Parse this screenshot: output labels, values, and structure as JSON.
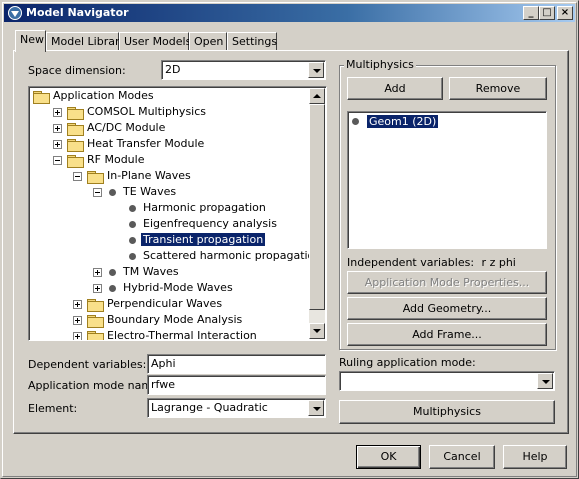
{
  "window": {
    "title": "Model Navigator"
  },
  "titlebar_buttons": {
    "minimize": "_",
    "maximize": "□",
    "close": "×"
  },
  "tabs": [
    {
      "label": "New",
      "active": true
    },
    {
      "label": "Model Library",
      "active": false
    },
    {
      "label": "User Models",
      "active": false
    },
    {
      "label": "Open",
      "active": false
    },
    {
      "label": "Settings",
      "active": false
    }
  ],
  "left": {
    "space_dimension_label": "Space dimension:",
    "space_dimension_value": "2D",
    "tree": [
      {
        "label": "Application Modes",
        "type": "folder",
        "level": 0,
        "expander": "minus"
      },
      {
        "label": "COMSOL Multiphysics",
        "type": "folder",
        "level": 1,
        "expander": "plus"
      },
      {
        "label": "AC/DC Module",
        "type": "folder",
        "level": 1,
        "expander": "plus"
      },
      {
        "label": "Heat Transfer Module",
        "type": "folder",
        "level": 1,
        "expander": "plus"
      },
      {
        "label": "RF Module",
        "type": "folder",
        "level": 1,
        "expander": "minus"
      },
      {
        "label": "In-Plane Waves",
        "type": "folder",
        "level": 2,
        "expander": "minus"
      },
      {
        "label": "TE Waves",
        "type": "dot",
        "level": 3,
        "expander": "minus"
      },
      {
        "label": "Harmonic propagation",
        "type": "dot",
        "level": 4,
        "expander": ""
      },
      {
        "label": "Eigenfrequency analysis",
        "type": "dot",
        "level": 4,
        "expander": ""
      },
      {
        "label": "Transient propagation",
        "type": "dot",
        "level": 4,
        "expander": "",
        "selected": true
      },
      {
        "label": "Scattered harmonic propagation",
        "type": "dot",
        "level": 4,
        "expander": ""
      },
      {
        "label": "TM Waves",
        "type": "dot",
        "level": 3,
        "expander": "plus"
      },
      {
        "label": "Hybrid-Mode Waves",
        "type": "dot",
        "level": 3,
        "expander": "plus"
      },
      {
        "label": "Perpendicular Waves",
        "type": "folder",
        "level": 2,
        "expander": "plus"
      },
      {
        "label": "Boundary Mode Analysis",
        "type": "folder",
        "level": 2,
        "expander": "plus"
      },
      {
        "label": "Electro-Thermal Interaction",
        "type": "folder",
        "level": 2,
        "expander": "plus"
      }
    ],
    "dependent_variables_label": "Dependent variables:",
    "dependent_variables_value": "Aphi",
    "application_mode_name_label": "Application mode name:",
    "application_mode_name_value": "rfwe",
    "element_label": "Element:",
    "element_value": "Lagrange - Quadratic"
  },
  "multiphysics": {
    "group_title": "Multiphysics",
    "add_label": "Add",
    "remove_label": "Remove",
    "list_items": [
      {
        "label": "Geom1 (2D)",
        "selected": true
      }
    ],
    "independent_variables_label": "Independent variables:",
    "independent_variables_value": "r z phi",
    "app_mode_properties_label": "Application Mode Properties...",
    "add_geometry_label": "Add Geometry...",
    "add_frame_label": "Add Frame...",
    "ruling_mode_label": "Ruling application mode:",
    "ruling_mode_value": "",
    "multiphysics_button_label": "Multiphysics"
  },
  "footer": {
    "ok_label": "OK",
    "cancel_label": "Cancel",
    "help_label": "Help"
  }
}
